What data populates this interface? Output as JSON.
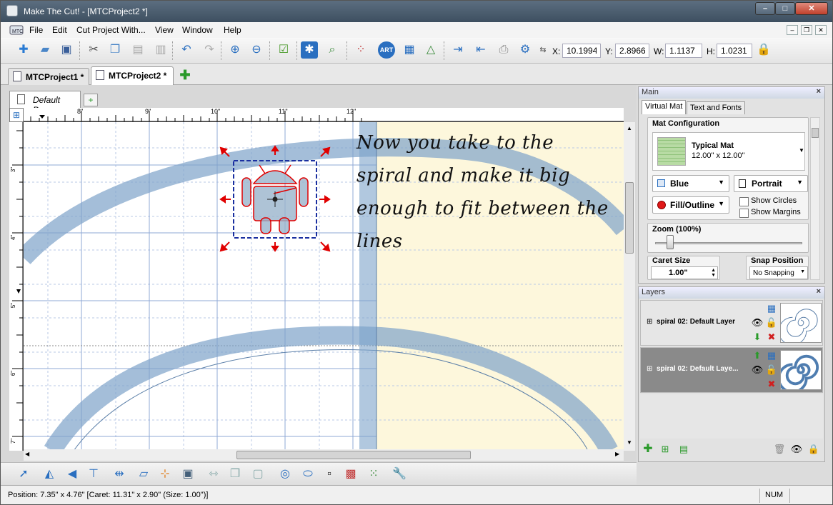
{
  "window": {
    "title": "Make The Cut! - [MTCProject2 *]",
    "controls": {
      "minimize": "–",
      "maximize": "□",
      "close": "✕"
    }
  },
  "menu": {
    "items": [
      "File",
      "Edit",
      "Cut Project With...",
      "View",
      "Window",
      "Help"
    ],
    "mdi_controls": [
      "–",
      "❐",
      "✕"
    ]
  },
  "toolbar": {
    "icons": [
      "new-icon",
      "open-icon",
      "save-icon",
      "cut-icon",
      "copy-icon",
      "paste-icon",
      "paste-in-place-icon",
      "undo-icon",
      "redo-icon",
      "zoom-in-icon",
      "zoom-out-icon",
      "approve-icon",
      "wand-icon",
      "zoom-fit-icon",
      "node-edit-icon",
      "art-icon",
      "grid-icon",
      "shapes-icon",
      "export-icon",
      "import-icon",
      "print-icon",
      "settings-icon"
    ],
    "x_label": "X:",
    "x_value": "10.1994",
    "y_label": "Y:",
    "y_value": "2.8966",
    "w_label": "W:",
    "w_value": "1.1137",
    "h_label": "H:",
    "h_value": "1.0231"
  },
  "project_tabs": [
    {
      "label": "MTCProject1 *",
      "active": false
    },
    {
      "label": "MTCProject2 *",
      "active": true
    }
  ],
  "page_tab": {
    "label": "Default Page"
  },
  "ruler": {
    "h_ticks": [
      "8\"",
      "9\"",
      "10\"",
      "11\"",
      "12\""
    ],
    "v_ticks": [
      "3\"",
      "4\"",
      "5\"",
      "6\"",
      "7\""
    ]
  },
  "annotation": {
    "lines": [
      "Now you take to the",
      "spiral and make it big",
      "enough to fit between the",
      "lines"
    ]
  },
  "main_panel": {
    "title": "Main",
    "tabs": [
      "Virtual Mat",
      "Text and Fonts"
    ],
    "mat_config_title": "Mat Configuration",
    "mat_name": "Typical Mat",
    "mat_size": "12.00\" x 12.00\"",
    "color_select": "Blue",
    "orientation_select": "Portrait",
    "fill_select": "Fill/Outline",
    "show_circles": "Show Circles",
    "show_margins": "Show Margins",
    "zoom_title": "Zoom (100%)",
    "caret_title": "Caret Size",
    "caret_value": "1.00\"",
    "snap_title": "Snap Position",
    "snap_value": "No Snapping"
  },
  "layers_panel": {
    "title": "Layers",
    "rows": [
      {
        "name": "spiral 02: Default Layer"
      },
      {
        "name": "spiral 02: Default Laye..."
      }
    ]
  },
  "status": {
    "position": "Position: 7.35\" x 4.76\" [Caret: 11.31\" x 2.90\" (Size: 1.00\")]",
    "num": "NUM"
  },
  "colors": {
    "title_bar": "#485a6c",
    "mat_blue": "#9dbcd6",
    "page_cream": "#fdf7dc",
    "selection": "#1a2fa0",
    "handle_red": "#e00000"
  }
}
